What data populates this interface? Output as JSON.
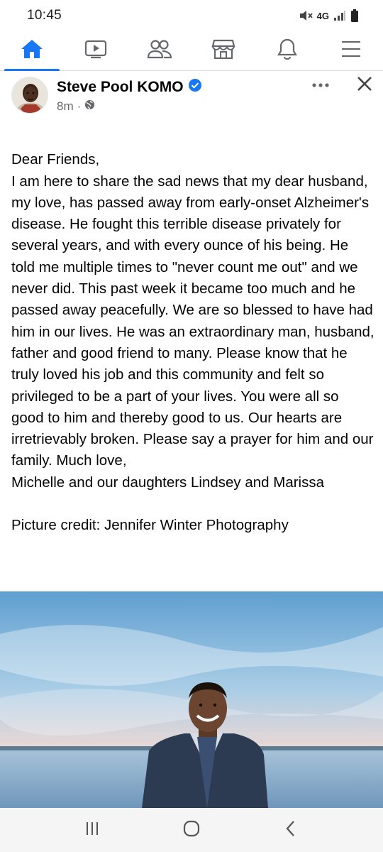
{
  "status_bar": {
    "time": "10:45",
    "network": "4G",
    "icons": [
      "mute-icon",
      "signal-icon",
      "battery-icon"
    ]
  },
  "nav": {
    "items": [
      {
        "icon": "home-icon",
        "active": true
      },
      {
        "icon": "video-icon",
        "active": false
      },
      {
        "icon": "friends-icon",
        "active": false
      },
      {
        "icon": "marketplace-icon",
        "active": false
      },
      {
        "icon": "bell-icon",
        "active": false
      },
      {
        "icon": "menu-icon",
        "active": false
      }
    ],
    "accent_color": "#1877f2"
  },
  "post": {
    "author": "Steve Pool KOMO",
    "verified": true,
    "time_ago": "8m",
    "separator": "·",
    "privacy_icon": "globe-icon",
    "body_paragraphs": [
      "Dear Friends,\nI am here to share the sad news that my dear husband, my love, has passed away from early-onset Alzheimer's disease.  He fought this terrible disease privately for several years, and with every ounce of his being. He told me multiple times to \"never count me out\" and we never did. This past week it became too much and he passed away peacefully.  We are so blessed to have had him in our lives.  He was an extraordinary man, husband, father and good friend to many.  Please know that he truly loved his job and this community and felt so privileged to be a part of your lives. You were all so good to him and thereby good to us.  Our hearts are irretrievably broken. Please say a prayer for him and our family.  Much love,\nMichelle and our daughters Lindsey and Marissa"
    ],
    "credit": "Picture credit:  Jennifer Winter Photography"
  },
  "android_nav": {
    "icons": [
      "recents-icon",
      "home-circle-icon",
      "back-icon"
    ]
  }
}
